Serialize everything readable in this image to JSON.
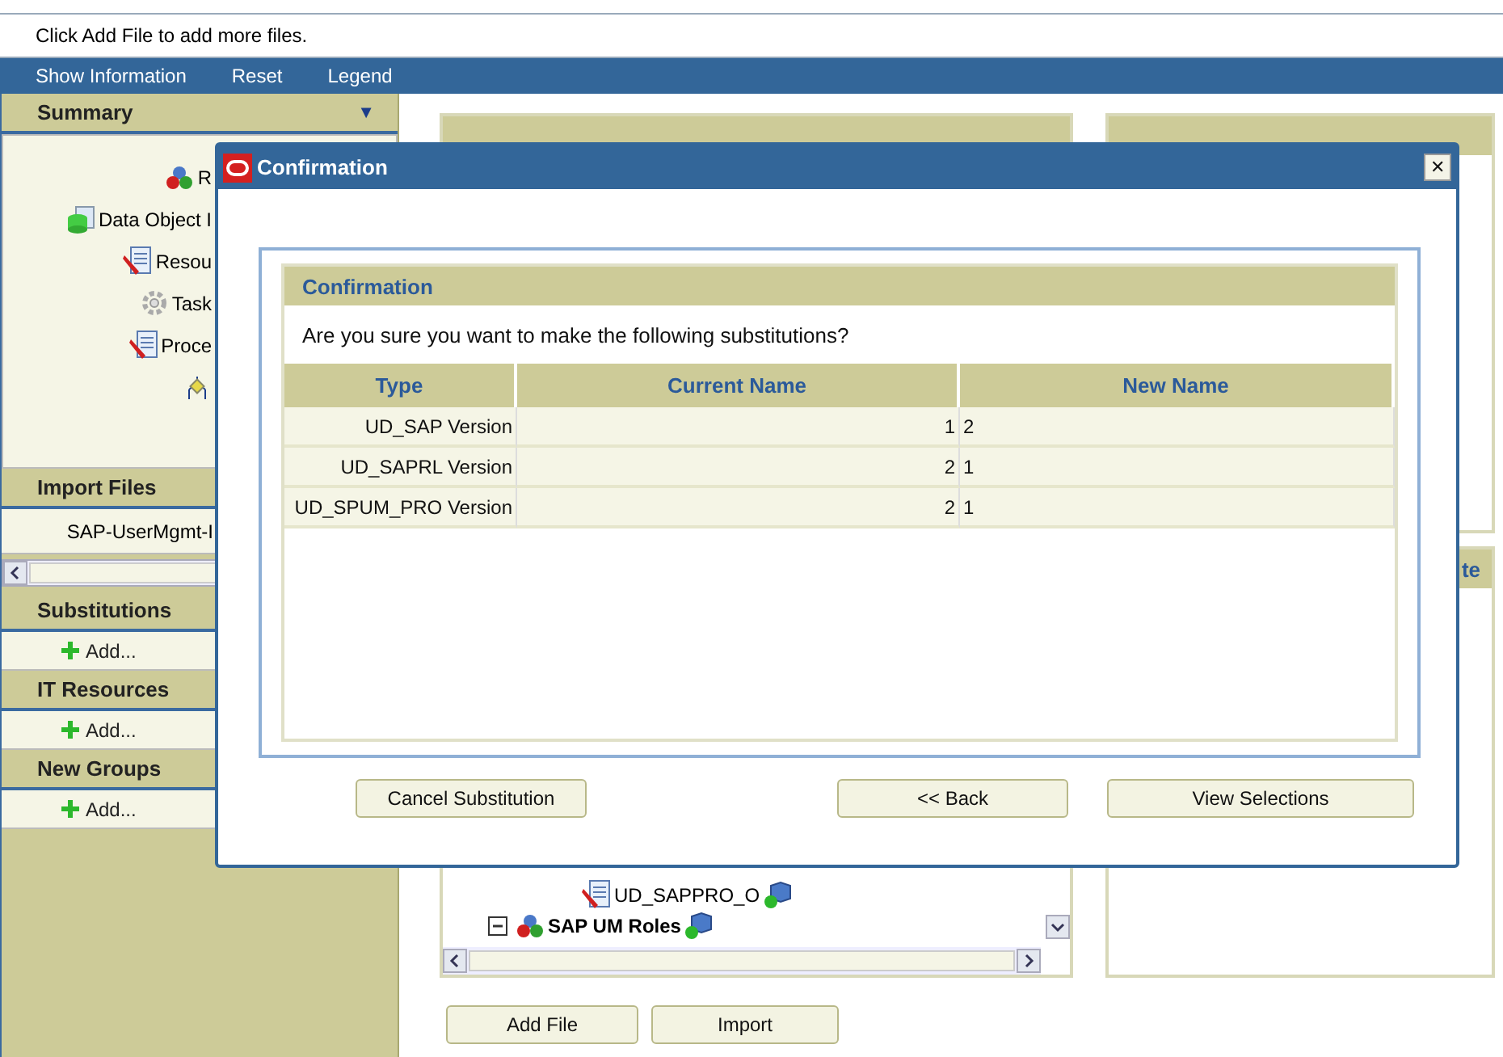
{
  "message_bar": {
    "text": "Click Add File to add more files."
  },
  "menu": [
    "Show Information",
    "Reset",
    "Legend"
  ],
  "sidebar": {
    "summary": {
      "title": "Summary",
      "toggle": "▼",
      "tree": [
        {
          "kind": "roles",
          "label": "R"
        },
        {
          "kind": "database",
          "label": "Data Object I"
        },
        {
          "kind": "document",
          "label": "Resou"
        },
        {
          "kind": "gear",
          "label": "Task"
        },
        {
          "kind": "document",
          "label": "Proce"
        },
        {
          "kind": "workflow"
        }
      ]
    },
    "import_files": {
      "title": "Import Files",
      "files": [
        "SAP-UserMgmt-I"
      ]
    },
    "sections": [
      {
        "title": "Substitutions",
        "action": "Add..."
      },
      {
        "title": "IT Resources",
        "action": "Add..."
      },
      {
        "title": "New Groups",
        "action": "Add..."
      }
    ]
  },
  "current_selections": {
    "tree": [
      {
        "kind": "document",
        "label": "UD_SAPPRO_O",
        "bold": false,
        "expanded": false
      },
      {
        "kind": "roles",
        "label": "SAP UM Roles",
        "bold": true,
        "expanded": true
      }
    ]
  },
  "panel_3": {
    "title": "te"
  },
  "buttons": [
    "Add File",
    "Import"
  ],
  "dialog": {
    "title": "Confirmation",
    "close": "✕",
    "panel_title": "Confirmation",
    "prompt": "Are you sure you want to make the following substitutions?",
    "columns": [
      "Type",
      "Current Name",
      "New Name"
    ],
    "rows": [
      [
        "UD_SAP Version",
        "1",
        "2"
      ],
      [
        "UD_SAPRL Version",
        "2",
        "1"
      ],
      [
        "UD_SPUM_PRO Version",
        "2",
        "1"
      ]
    ],
    "buttons": [
      "Cancel Substitution",
      "<< Back",
      "View Selections"
    ]
  }
}
